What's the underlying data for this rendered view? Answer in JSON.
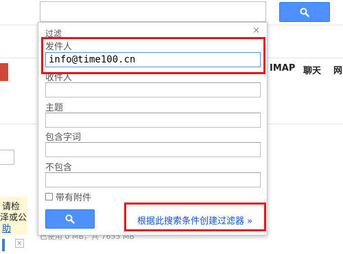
{
  "background": {
    "nav": {
      "imap": "IMAP",
      "chat": "聊天",
      "cut_off": "网"
    },
    "notice": {
      "line1": "请检",
      "line2": "泽或公",
      "link": "助"
    },
    "usage": "已使用 0 MB，共 7655 MB"
  },
  "filter_popup": {
    "title": "过滤",
    "close_label": "×",
    "fields": [
      {
        "label": "发件人",
        "value": "info@time100.cn"
      },
      {
        "label": "收件人",
        "value": ""
      },
      {
        "label": "主题",
        "value": ""
      },
      {
        "label": "包含字词",
        "value": ""
      },
      {
        "label": "不包含",
        "value": ""
      }
    ],
    "has_attachment_label": "带有附件",
    "create_filter_link": "根据此搜索条件创建过滤器 »"
  },
  "colors": {
    "accent_blue": "#4d90fe",
    "highlight_red": "#e8141c",
    "link_blue": "#1155cc"
  },
  "icons": {
    "search": "magnifier-icon"
  }
}
